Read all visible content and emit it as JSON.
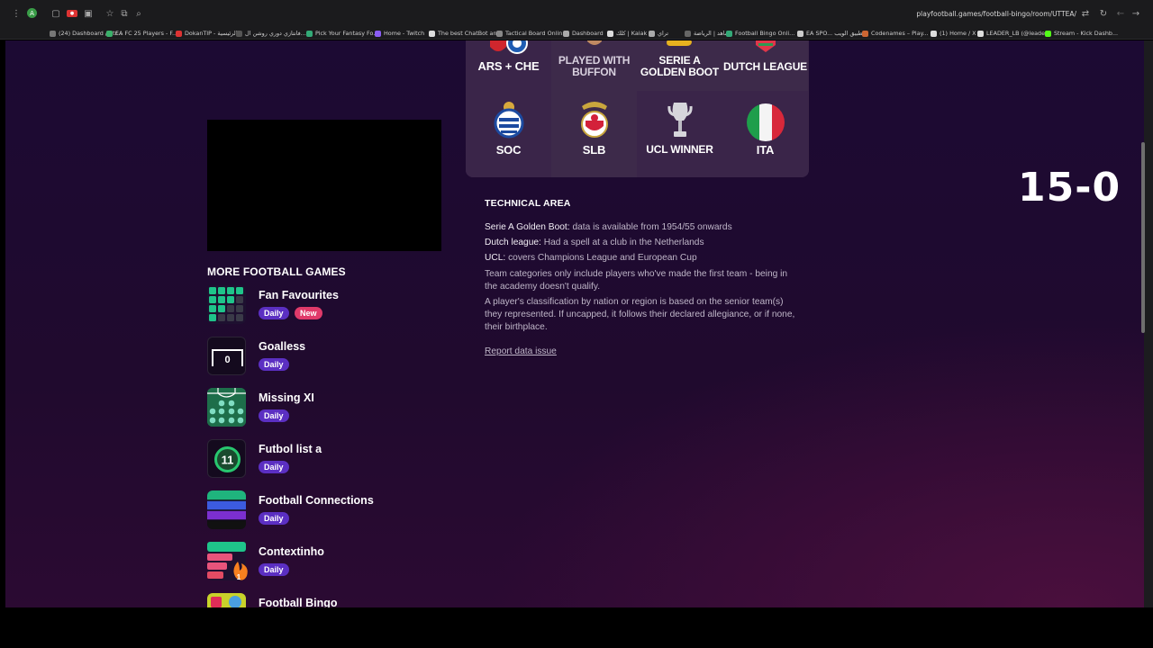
{
  "browser": {
    "url": "playfootball.games/football-bingo/room/UTTEA/",
    "bookmarks": [
      {
        "label": "(24) Dashboard / Str...",
        "color": "#777"
      },
      {
        "label": "EA FC 25 Players - F...",
        "color": "#3ab06a"
      },
      {
        "label": "DokanTIP - الرئيسية",
        "color": "#d33"
      },
      {
        "label": "فانتازي دوري روشن ال...",
        "color": "#555"
      },
      {
        "label": "Pick Your Fantasy Fo...",
        "color": "#3a7"
      },
      {
        "label": "Home - Twitch",
        "color": "#8a5cf5"
      },
      {
        "label": "The best ChatBot an...",
        "color": "#ddd"
      },
      {
        "label": "Tactical Board Onlin...",
        "color": "#888"
      },
      {
        "label": "Dashboard",
        "color": "#aaa"
      },
      {
        "label": "كلك | Kaiak",
        "color": "#ddd"
      },
      {
        "label": "تراي",
        "color": "#aaa"
      },
      {
        "label": "شاهد | الرياضة",
        "color": "#666"
      },
      {
        "label": "Football Bingo Onli...",
        "color": "#3a7"
      },
      {
        "label": "EA SPO... تطبيق الويب",
        "color": "#ccc"
      },
      {
        "label": "Codenames – Play...",
        "color": "#c63"
      },
      {
        "label": "(1) Home / X",
        "color": "#ddd"
      },
      {
        "label": "LEADER_LB (@leade...",
        "color": "#ddd"
      },
      {
        "label": "Stream - Kick Dashb...",
        "color": "#53fc18"
      }
    ]
  },
  "bingo_grid": [
    {
      "label": "ARS + CHE",
      "icon": "arsenal-chelsea-crests"
    },
    {
      "label": "PLAYED WITH BUFFON",
      "icon": "buffon-portrait"
    },
    {
      "label": "SERIE A GOLDEN BOOT",
      "icon": "golden-boot-icon"
    },
    {
      "label": "DUTCH LEAGUE",
      "icon": "dutch-league-icon"
    },
    {
      "label": "SOC",
      "icon": "real-sociedad-crest"
    },
    {
      "label": "SLB",
      "icon": "benfica-crest"
    },
    {
      "label": "UCL WINNER",
      "icon": "champions-league-trophy"
    },
    {
      "label": "ITA",
      "icon": "italy-flag"
    }
  ],
  "technical_area": {
    "title": "TECHNICAL AREA",
    "lines": [
      {
        "term": "Serie A Golden Boot:",
        "text": "data is available from 1954/55 onwards"
      },
      {
        "term": "Dutch league:",
        "text": "Had a spell at a club in the Netherlands"
      },
      {
        "term": "UCL:",
        "text": "covers Champions League and European Cup"
      },
      {
        "term": "",
        "text": "Team categories only include players who've made the first team - being in the academy doesn't qualify."
      },
      {
        "term": "",
        "text": "A player's classification by nation or region is based on the senior team(s) they represented. If uncapped, it follows their declared allegiance, or if none, their birthplace."
      }
    ],
    "report_link": "Report data issue"
  },
  "score": "15-0",
  "more_games": {
    "title": "MORE FOOTBALL GAMES",
    "games": [
      {
        "name": "Fan Favourites",
        "badges": [
          "Daily",
          "New"
        ],
        "icon": "fan-favourites-grid-icon"
      },
      {
        "name": "Goalless",
        "badges": [
          "Daily"
        ],
        "icon": "goalless-icon",
        "icon_text": "0"
      },
      {
        "name": "Missing XI",
        "badges": [
          "Daily"
        ],
        "icon": "missing-xi-pitch-icon"
      },
      {
        "name": "Futbol list a",
        "badges": [
          "Daily"
        ],
        "icon": "futbol-lista-icon",
        "icon_text": "11"
      },
      {
        "name": "Football Connections",
        "badges": [
          "Daily"
        ],
        "icon": "football-connections-icon"
      },
      {
        "name": "Contextinho",
        "badges": [
          "Daily"
        ],
        "icon": "contextinho-icon",
        "icon_text": "1"
      },
      {
        "name": "Football Bingo",
        "badges": [],
        "icon": "football-bingo-icon"
      }
    ]
  }
}
